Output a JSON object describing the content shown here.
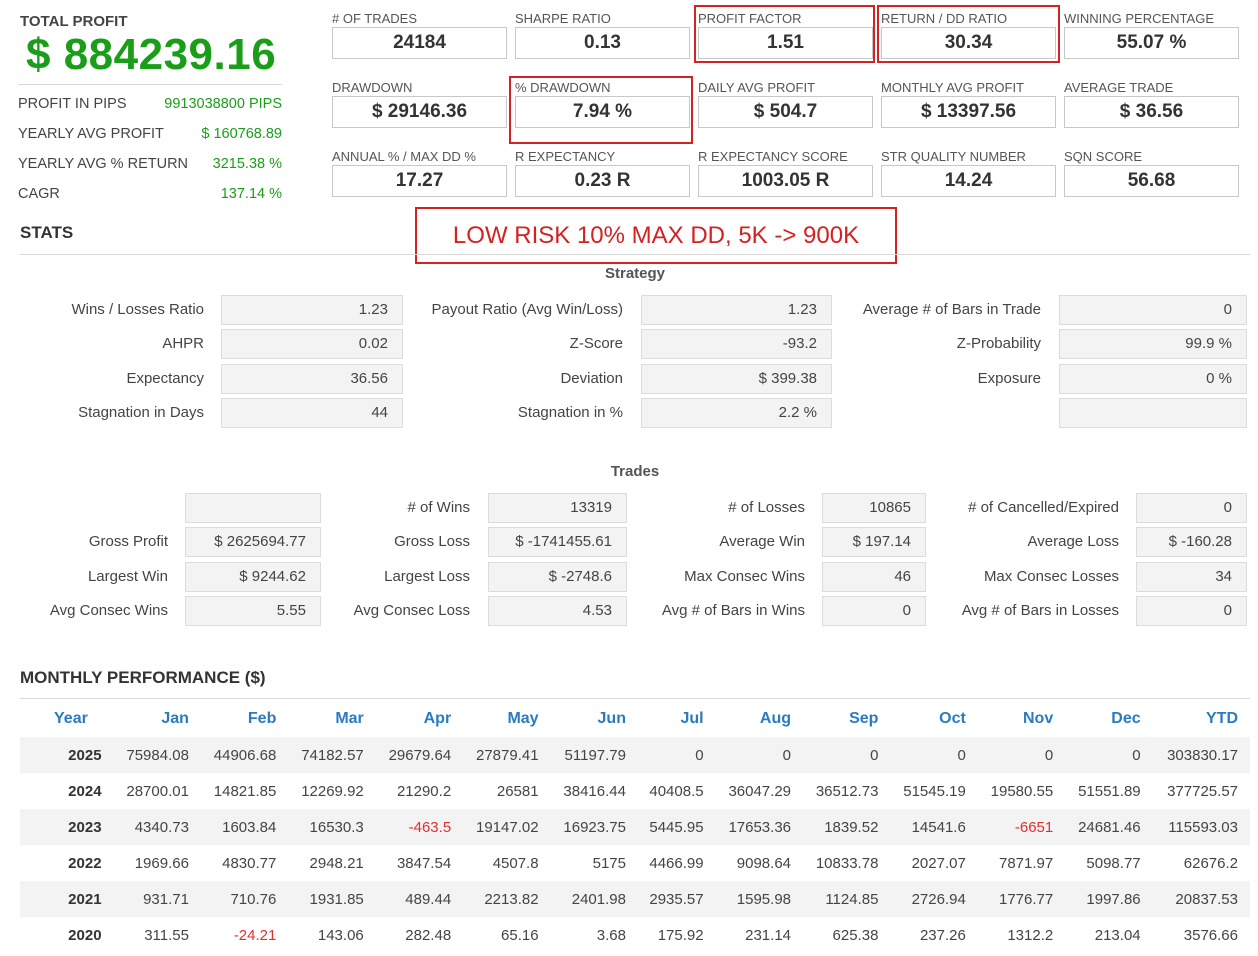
{
  "summary": {
    "total_profit_label": "TOTAL PROFIT",
    "total_profit_value": "$ 884239.16",
    "rows": [
      {
        "label": "PROFIT IN PIPS",
        "value": "9913038800 PIPS"
      },
      {
        "label": "YEARLY AVG PROFIT",
        "value": "$ 160768.89"
      },
      {
        "label": "YEARLY AVG % RETURN",
        "value": "3215.38 %"
      },
      {
        "label": "CAGR",
        "value": "137.14 %"
      }
    ]
  },
  "metrics": [
    {
      "label": "# OF TRADES",
      "value": "24184"
    },
    {
      "label": "SHARPE RATIO",
      "value": "0.13"
    },
    {
      "label": "PROFIT FACTOR",
      "value": "1.51"
    },
    {
      "label": "RETURN / DD RATIO",
      "value": "30.34"
    },
    {
      "label": "WINNING PERCENTAGE",
      "value": "55.07 %"
    },
    {
      "label": "DRAWDOWN",
      "value": "$ 29146.36"
    },
    {
      "label": "% DRAWDOWN",
      "value": "7.94 %"
    },
    {
      "label": "DAILY AVG PROFIT",
      "value": "$ 504.7"
    },
    {
      "label": "MONTHLY AVG PROFIT",
      "value": "$ 13397.56"
    },
    {
      "label": "AVERAGE TRADE",
      "value": "$ 36.56"
    },
    {
      "label": "ANNUAL % / MAX DD %",
      "value": "17.27"
    },
    {
      "label": "R EXPECTANCY",
      "value": "0.23 R"
    },
    {
      "label": "R EXPECTANCY SCORE",
      "value": "1003.05 R"
    },
    {
      "label": "STR QUALITY NUMBER",
      "value": "14.24"
    },
    {
      "label": "SQN SCORE",
      "value": "56.68"
    }
  ],
  "highlight_color": "#d42121",
  "banner": "LOW RISK 10% MAX DD, 5K -> 900K",
  "stats": {
    "title": "STATS",
    "strategy_title": "Strategy",
    "strategy": [
      [
        {
          "label": "Wins / Losses Ratio",
          "value": "1.23"
        },
        {
          "label": "Payout Ratio (Avg Win/Loss)",
          "value": "1.23"
        },
        {
          "label": "Average # of Bars in Trade",
          "value": "0"
        }
      ],
      [
        {
          "label": "AHPR",
          "value": "0.02"
        },
        {
          "label": "Z-Score",
          "value": "-93.2"
        },
        {
          "label": "Z-Probability",
          "value": "99.9 %"
        }
      ],
      [
        {
          "label": "Expectancy",
          "value": "36.56"
        },
        {
          "label": "Deviation",
          "value": "$ 399.38"
        },
        {
          "label": "Exposure",
          "value": "0 %"
        }
      ],
      [
        {
          "label": "Stagnation in Days",
          "value": "44"
        },
        {
          "label": "Stagnation in %",
          "value": "2.2 %"
        },
        {
          "label": "",
          "value": ""
        }
      ]
    ],
    "trades_title": "Trades",
    "trades": [
      [
        {
          "label": "",
          "value": ""
        },
        {
          "label": "# of Wins",
          "value": "13319"
        },
        {
          "label": "# of Losses",
          "value": "10865"
        },
        {
          "label": "# of Cancelled/Expired",
          "value": "0"
        }
      ],
      [
        {
          "label": "Gross Profit",
          "value": "$ 2625694.77"
        },
        {
          "label": "Gross Loss",
          "value": "$ -1741455.61"
        },
        {
          "label": "Average Win",
          "value": "$ 197.14"
        },
        {
          "label": "Average Loss",
          "value": "$ -160.28"
        }
      ],
      [
        {
          "label": "Largest Win",
          "value": "$ 9244.62"
        },
        {
          "label": "Largest Loss",
          "value": "$ -2748.6"
        },
        {
          "label": "Max Consec Wins",
          "value": "46"
        },
        {
          "label": "Max Consec Losses",
          "value": "34"
        }
      ],
      [
        {
          "label": "Avg Consec Wins",
          "value": "5.55"
        },
        {
          "label": "Avg Consec Loss",
          "value": "4.53"
        },
        {
          "label": "Avg # of Bars in Wins",
          "value": "0"
        },
        {
          "label": "Avg # of Bars in Losses",
          "value": "0"
        }
      ]
    ]
  },
  "monthly": {
    "title": "MONTHLY PERFORMANCE ($)",
    "negative_color": "#e03030",
    "headers": [
      "Year",
      "Jan",
      "Feb",
      "Mar",
      "Apr",
      "May",
      "Jun",
      "Jul",
      "Aug",
      "Sep",
      "Oct",
      "Nov",
      "Dec",
      "YTD"
    ],
    "rows": [
      [
        "2025",
        "75984.08",
        "44906.68",
        "74182.57",
        "29679.64",
        "27879.41",
        "51197.79",
        "0",
        "0",
        "0",
        "0",
        "0",
        "0",
        "303830.17"
      ],
      [
        "2024",
        "28700.01",
        "14821.85",
        "12269.92",
        "21290.2",
        "26581",
        "38416.44",
        "40408.5",
        "36047.29",
        "36512.73",
        "51545.19",
        "19580.55",
        "51551.89",
        "377725.57"
      ],
      [
        "2023",
        "4340.73",
        "1603.84",
        "16530.3",
        "-463.5",
        "19147.02",
        "16923.75",
        "5445.95",
        "17653.36",
        "1839.52",
        "14541.6",
        "-6651",
        "24681.46",
        "115593.03"
      ],
      [
        "2022",
        "1969.66",
        "4830.77",
        "2948.21",
        "3847.54",
        "4507.8",
        "5175",
        "4466.99",
        "9098.64",
        "10833.78",
        "2027.07",
        "7871.97",
        "5098.77",
        "62676.2"
      ],
      [
        "2021",
        "931.71",
        "710.76",
        "1931.85",
        "489.44",
        "2213.82",
        "2401.98",
        "2935.57",
        "1595.98",
        "1124.85",
        "2726.94",
        "1776.77",
        "1997.86",
        "20837.53"
      ],
      [
        "2020",
        "311.55",
        "-24.21",
        "143.06",
        "282.48",
        "65.16",
        "3.68",
        "175.92",
        "231.14",
        "625.38",
        "237.26",
        "1312.2",
        "213.04",
        "3576.66"
      ]
    ]
  }
}
